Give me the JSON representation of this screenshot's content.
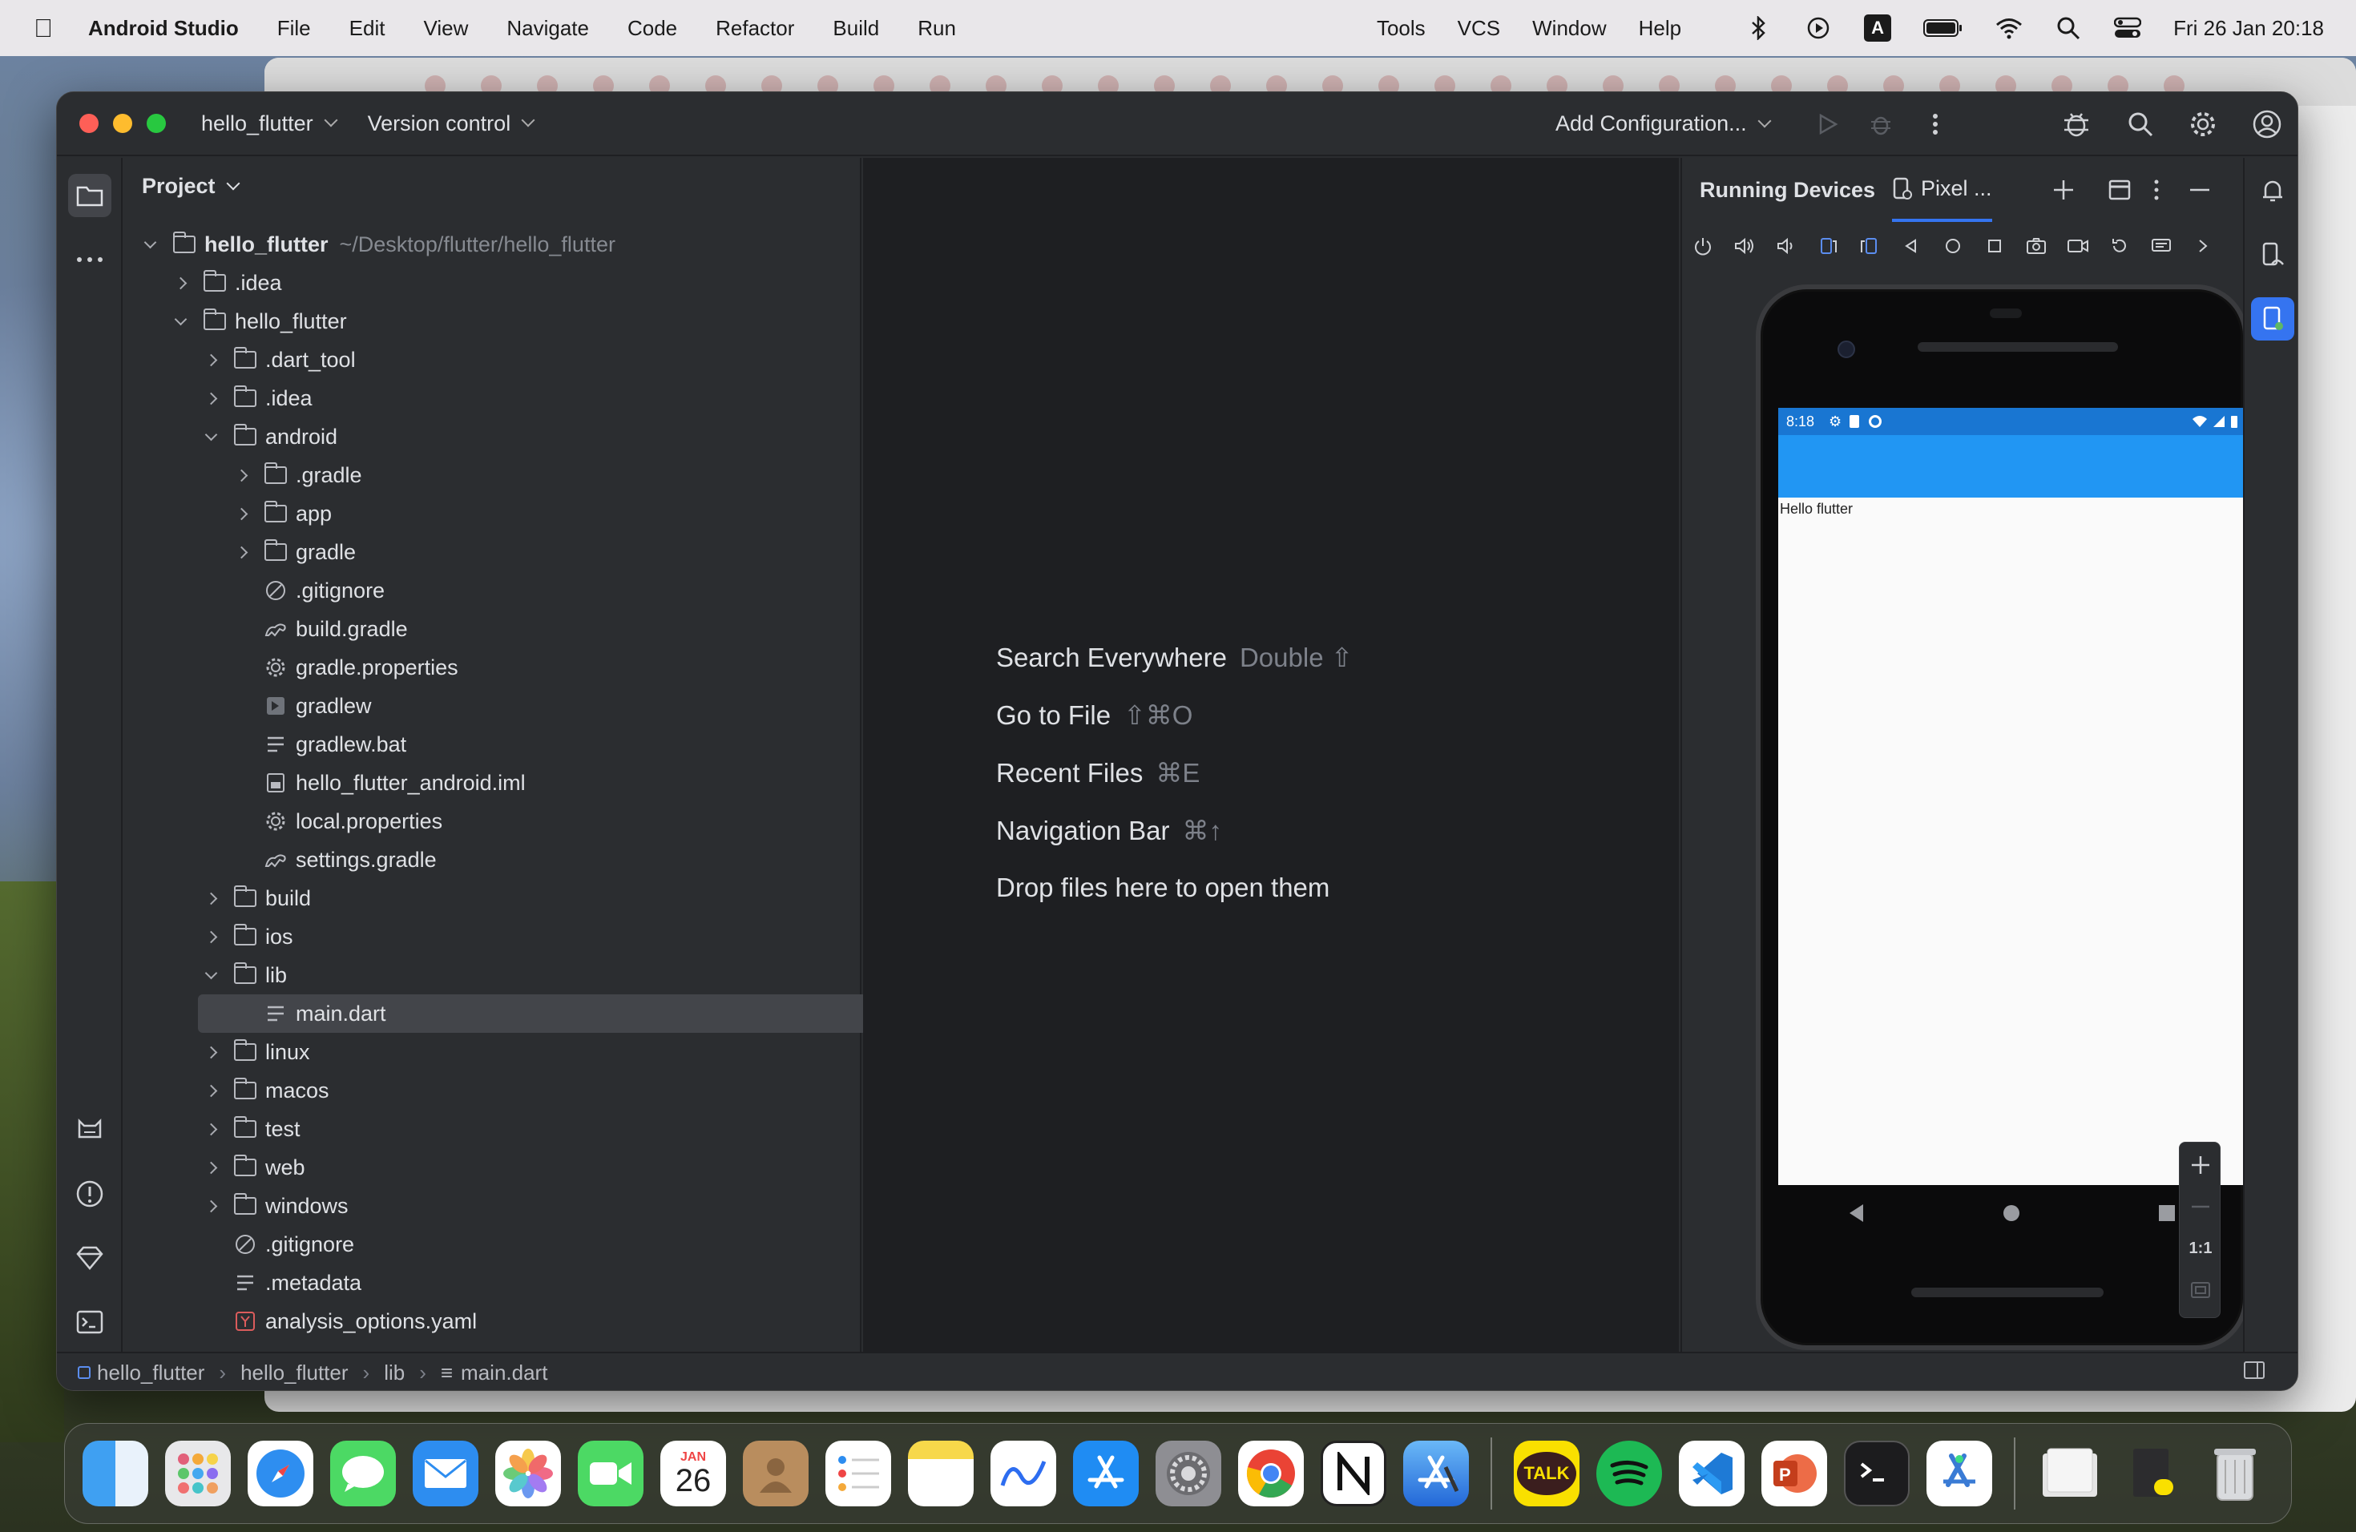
{
  "menubar": {
    "app_name": "Android Studio",
    "items": [
      "File",
      "Edit",
      "View",
      "Navigate",
      "Code",
      "Refactor",
      "Build",
      "Run"
    ],
    "right_items": [
      "Tools",
      "VCS",
      "Window",
      "Help"
    ],
    "input_source": "A",
    "datetime": "Fri 26 Jan  20:18"
  },
  "window": {
    "project_name": "hello_flutter",
    "version_control": "Version control",
    "run_config": "Add Configuration..."
  },
  "project_panel": {
    "title": "Project",
    "root_name": "hello_flutter",
    "root_path": "~/Desktop/flutter/hello_flutter",
    "items": [
      {
        "label": ".idea"
      },
      {
        "label": "hello_flutter"
      },
      {
        "label": ".dart_tool"
      },
      {
        "label": ".idea"
      },
      {
        "label": "android"
      },
      {
        "label": ".gradle"
      },
      {
        "label": "app"
      },
      {
        "label": "gradle"
      },
      {
        "label": ".gitignore"
      },
      {
        "label": "build.gradle"
      },
      {
        "label": "gradle.properties"
      },
      {
        "label": "gradlew"
      },
      {
        "label": "gradlew.bat"
      },
      {
        "label": "hello_flutter_android.iml"
      },
      {
        "label": "local.properties"
      },
      {
        "label": "settings.gradle"
      },
      {
        "label": "build"
      },
      {
        "label": "ios"
      },
      {
        "label": "lib"
      },
      {
        "label": "main.dart"
      },
      {
        "label": "linux"
      },
      {
        "label": "macos"
      },
      {
        "label": "test"
      },
      {
        "label": "web"
      },
      {
        "label": "windows"
      },
      {
        "label": ".gitignore"
      },
      {
        "label": ".metadata"
      },
      {
        "label": "analysis_options.yaml"
      }
    ]
  },
  "editor_hints": [
    {
      "label": "Search Everywhere",
      "shortcut": "Double ⇧"
    },
    {
      "label": "Go to File",
      "shortcut": "⇧⌘O"
    },
    {
      "label": "Recent Files",
      "shortcut": "⌘E"
    },
    {
      "label": "Navigation Bar",
      "shortcut": "⌘↑"
    },
    {
      "label": "Drop files here to open them",
      "shortcut": ""
    }
  ],
  "running_devices": {
    "title": "Running Devices",
    "device_tab": "Pixel ...",
    "zoom_label": "1:1",
    "phone": {
      "time": "8:18",
      "body_text": "Hello flutter"
    }
  },
  "breadcrumb": [
    "hello_flutter",
    "hello_flutter",
    "lib",
    "main.dart"
  ],
  "dock": {
    "calendar_month": "JAN",
    "calendar_day": "26",
    "talk_label": "TALK"
  }
}
